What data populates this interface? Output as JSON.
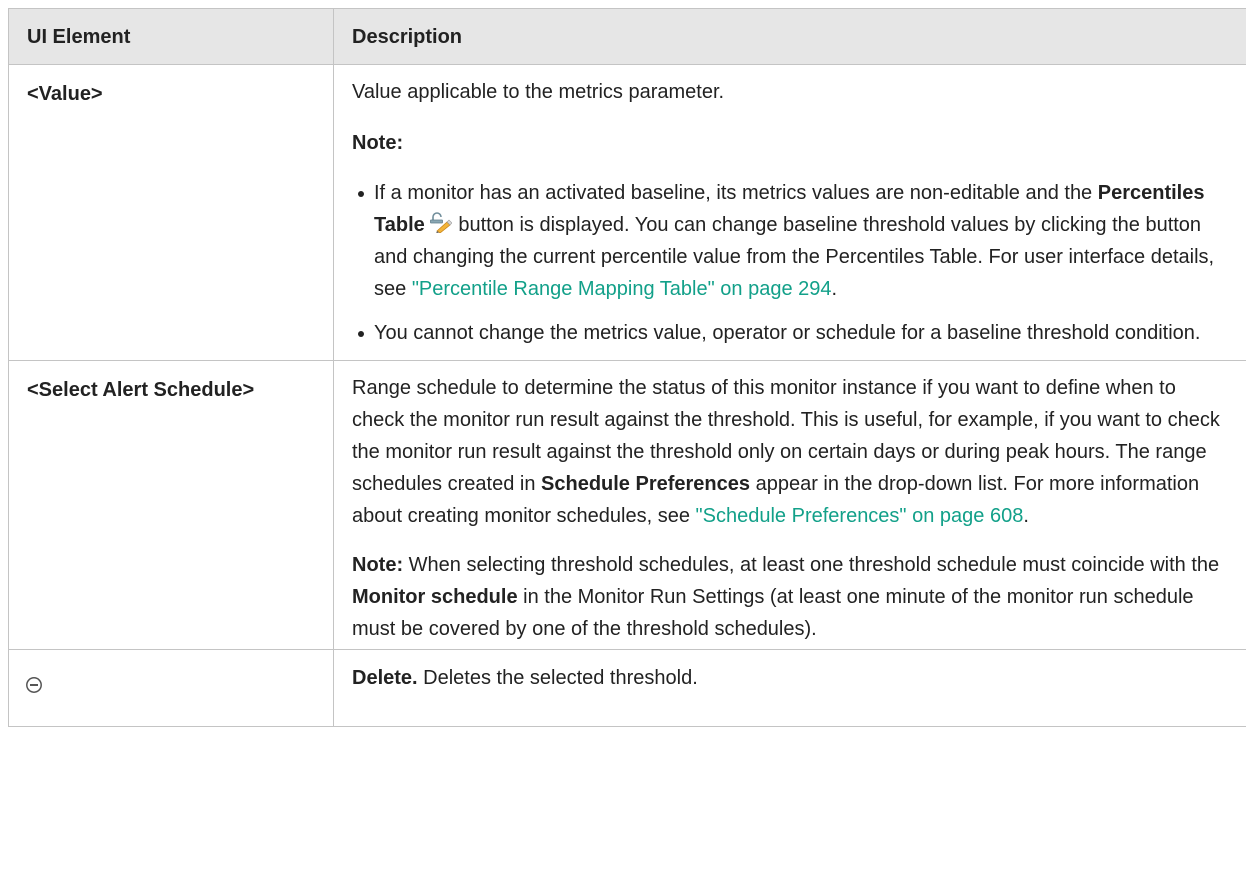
{
  "table": {
    "header": {
      "col1": "UI Element",
      "col2": "Description"
    },
    "rows": [
      {
        "element": "<Value>",
        "intro": "Value applicable to the metrics parameter.",
        "note_label": "Note:",
        "bullet1": {
          "pre": "If a monitor has an activated baseline, its metrics values are non-editable and the ",
          "bold": "Percentiles Table",
          "icon": "percentiles-table-icon",
          "mid": " button is displayed. You can change baseline threshold values by clicking the button and changing the current percentile value from the Percentiles Table. For user interface details, see ",
          "link": "\"Percentile Range Mapping Table\" on page 294",
          "post": "."
        },
        "bullet2": "You cannot change the metrics value, operator or schedule for a baseline threshold condition."
      },
      {
        "element": "<Select Alert Schedule>",
        "para1": {
          "pre": "Range schedule to determine the status of this monitor instance if you want to define when to check the monitor run result against the threshold. This is useful, for example, if you want to check the monitor run result against the threshold only on certain days or during peak hours. The range schedules created in ",
          "bold": "Schedule Preferences",
          "mid": " appear in the drop-down list. For more information about creating monitor schedules, see ",
          "link": "\"Schedule Preferences\" on page 608",
          "post": "."
        },
        "para2": {
          "bold": "Note:",
          "pre": " When selecting threshold schedules, at least one threshold schedule must coincide with the ",
          "bold2": "Monitor schedule",
          "post": " in the Monitor Run Settings (at least one minute of the monitor run schedule must be covered by one of the threshold schedules)."
        }
      },
      {
        "element_icon": "delete-icon",
        "bold": "Delete.",
        "text": " Deletes the selected threshold."
      }
    ]
  },
  "colors": {
    "header_bg": "#e6e6e6",
    "border": "#c4c4c4",
    "link": "#12a089",
    "text": "#222222"
  }
}
